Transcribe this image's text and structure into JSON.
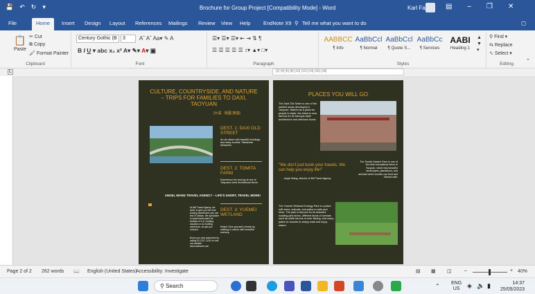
{
  "titlebar": {
    "title": "Brochure for Group Project [Compatibility Mode] - Word",
    "user": "Karl Fan"
  },
  "tabs": [
    "File",
    "Home",
    "Insert",
    "Design",
    "Layout",
    "References",
    "Mailings",
    "Review",
    "View",
    "Help",
    "EndNote X9"
  ],
  "tell_me": "Tell me what you want to do",
  "clipboard": {
    "paste": "Paste",
    "cut": "Cut",
    "copy": "Copy",
    "format_painter": "Format Painter",
    "label": "Clipboard"
  },
  "font": {
    "name": "Century Gothic (B",
    "size": "3",
    "label": "Font"
  },
  "paragraph": {
    "label": "Paragraph"
  },
  "styles": {
    "items": [
      {
        "preview": "AABBCC",
        "name": "¶ Info"
      },
      {
        "preview": "AaBbCcl",
        "name": "¶ Normal"
      },
      {
        "preview": "AaBbCcl",
        "name": "¶ Quote S..."
      },
      {
        "preview": "AaBbCc",
        "name": "¶ Services"
      },
      {
        "preview": "AABI",
        "name": "Heading 1"
      }
    ],
    "label": "Styles"
  },
  "editing": {
    "find": "Find",
    "replace": "Replace",
    "select": "Select",
    "label": "Editing"
  },
  "ruler": "|2| |4| |6| |8| |10| |12| |14| |16| |18|",
  "page1": {
    "title": "CULTURE, COUNTRYSIDE, AND NATURE – TRIPS FOR FAMILIES TO DAXI, TAOYUAN",
    "chinese": "[大溪 · 桃園 旅遊]",
    "dest1_title": "DEST. 1: DAXI OLD STREET",
    "dest1_text": "An old street with beautiful buildings and many tourists. Taiwanese delicacies.",
    "dest2_title": "DEST. 2: TOMITA FARM",
    "dest2_text": "Experience fun and joy at one of Taoyuan's best recreational farms.",
    "agency_title": "ANGEL WANG TRAVEL AGENCY – LIFE'S SHORT, TRAVEL MORE!",
    "agency_text": "At AW Travel Agency, we strive to give you the best touring experiences you can find in Taiwan. We specialize in small travel plans for families of 4-8, creating vacation or an exciting adventure, we get you covered.",
    "agency_text2": "Book your next adventure by calling 02-2317-1234 or visit our website: www.awtravel.com",
    "dest3_title": "DEST. 3: YUEMEI WETLAND",
    "dest3_text": "Relax! Give yourself a break by walking in nature with beautiful scenery."
  },
  "page2": {
    "title": "PLACES YOU WILL GO",
    "daxi_text": "The Daxi Old Street is one of the earliest areas developed in Taoyuan. Started as a place for people to trade, the street is now famous for its baroque-style architecture and delicious foods.",
    "quote": "\"We don't just book your travels. We can help you enjoy life!\"",
    "quote_by": "-   Angel Wang, director of AW Travel Agency",
    "tomita_text": "The Tomita Garden Farm is one of the best recreational farms in Taoyuan, which has beautiful landscapes, plantations, and animals which tourists can feed and interact with.",
    "yuemei_text": "The Yuemei Wetland Ecology Park is a place with trees, animals, and paths to walk and relax. The park is famous for its beautiful nodding pink lanes, different kinds of animals such as white herons or river fishing, and many paths for tourists to simply walk and enjoy nature."
  },
  "status": {
    "page": "Page 2 of 2",
    "words": "262 words",
    "language": "English (United States)",
    "accessibility": "Accessibility: Investigate",
    "zoom": "40%"
  },
  "taskbar": {
    "search": "Search",
    "lang": "ENG",
    "region": "US",
    "time": "14:37",
    "date": "25/05/2023"
  },
  "colors": {
    "accent": "#2b579a",
    "page_bg": "#2f3220",
    "gold": "#e3a33a"
  }
}
